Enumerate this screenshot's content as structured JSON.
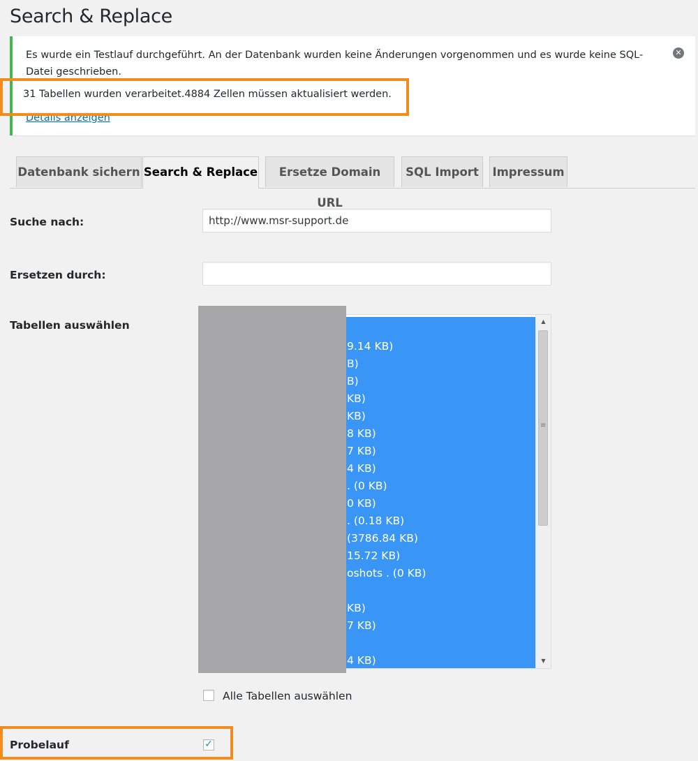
{
  "page": {
    "title": "Search & Replace"
  },
  "notice": {
    "message": "Es wurde ein Testlauf durchgeführt. An der Datenbank wurden keine Änderungen vorgenommen und es wurde keine SQL-Datei geschrieben.",
    "stats": "31 Tabellen wurden verarbeitet.4884 Zellen müssen aktualisiert werden.",
    "details_link": "Details anzeigen",
    "dismiss_icon": "✕"
  },
  "tabs": [
    {
      "label": "Datenbank sichern"
    },
    {
      "label": "Search & Replace"
    },
    {
      "label": "Ersetze Domain URL"
    },
    {
      "label": "SQL Import"
    },
    {
      "label": "Impressum"
    }
  ],
  "form": {
    "search_label": "Suche nach:",
    "search_value": "http://www.msr-support.de",
    "replace_label": "Ersetzen durch:",
    "replace_value": "",
    "tables_label": "Tabellen auswählen",
    "select_all_label": "Alle Tabellen auswählen",
    "dryrun_label": "Probelauf",
    "dryrun_checked": "✓"
  },
  "tables": [
    "",
    "9.14 KB)",
    "B)",
    "B)",
    " KB)",
    " KB)",
    "8 KB)",
    "7 KB)",
    "4 KB)",
    ". (0 KB)",
    "0 KB)",
    ". (0.18 KB)",
    " (3786.84 KB)",
    "15.72 KB)",
    "oshots . (0 KB)",
    "",
    "KB)",
    "7 KB)",
    "",
    "4 KB)"
  ],
  "scrollbar": {
    "up_icon": "▲",
    "down_icon": "▼",
    "grip_icon": "≡"
  }
}
